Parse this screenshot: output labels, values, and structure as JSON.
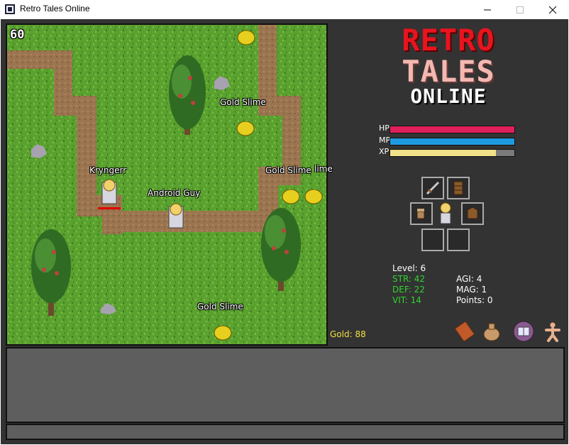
{
  "window": {
    "title": "Retro Tales Online",
    "controls": [
      "minimize",
      "maximize",
      "close"
    ]
  },
  "game": {
    "fps": "60",
    "labels": [
      {
        "id": "player",
        "text": "Kryngerr"
      },
      {
        "id": "other_player",
        "text": "Android Guy"
      },
      {
        "id": "slime1",
        "text": "Gold Slime"
      },
      {
        "id": "slime2",
        "text": "Gold Slime"
      },
      {
        "id": "slime3",
        "text": "Gold Slime"
      },
      {
        "id": "slime4_partial",
        "text": "lime"
      }
    ]
  },
  "logo": {
    "line1": "RETRO",
    "line2": "TALES",
    "line3": "ONLINE"
  },
  "bars": {
    "hp": {
      "label": "HP",
      "fraction": 1.0,
      "color": "#e0205a"
    },
    "mp": {
      "label": "MP",
      "fraction": 1.0,
      "color": "#1e9be0"
    },
    "xp": {
      "label": "XP",
      "fraction": 0.85,
      "color": "#f2e28a"
    }
  },
  "equipment": {
    "slots": [
      {
        "name": "weapon",
        "icon": "sword-icon"
      },
      {
        "name": "offhand",
        "icon": "shield-icon"
      },
      {
        "name": "gloves",
        "icon": "glove-icon"
      },
      {
        "name": "avatar",
        "icon": "character-icon"
      },
      {
        "name": "armor",
        "icon": "armor-icon"
      },
      {
        "name": "empty1",
        "icon": ""
      },
      {
        "name": "empty2",
        "icon": ""
      }
    ]
  },
  "stats": {
    "level": "Level: 6",
    "str": "STR: 42",
    "def": "DEF: 22",
    "vit": "VIT: 14",
    "agi": "AGI: 4",
    "mag": "MAG: 1",
    "points": "Points: 0",
    "colors": {
      "primary": "#ffffff",
      "boosted": "#2fd52f"
    }
  },
  "gold": "Gold: 88",
  "menu": [
    "spellbook-icon",
    "inventory-bag-icon",
    "magic-book-icon",
    "character-icon"
  ]
}
